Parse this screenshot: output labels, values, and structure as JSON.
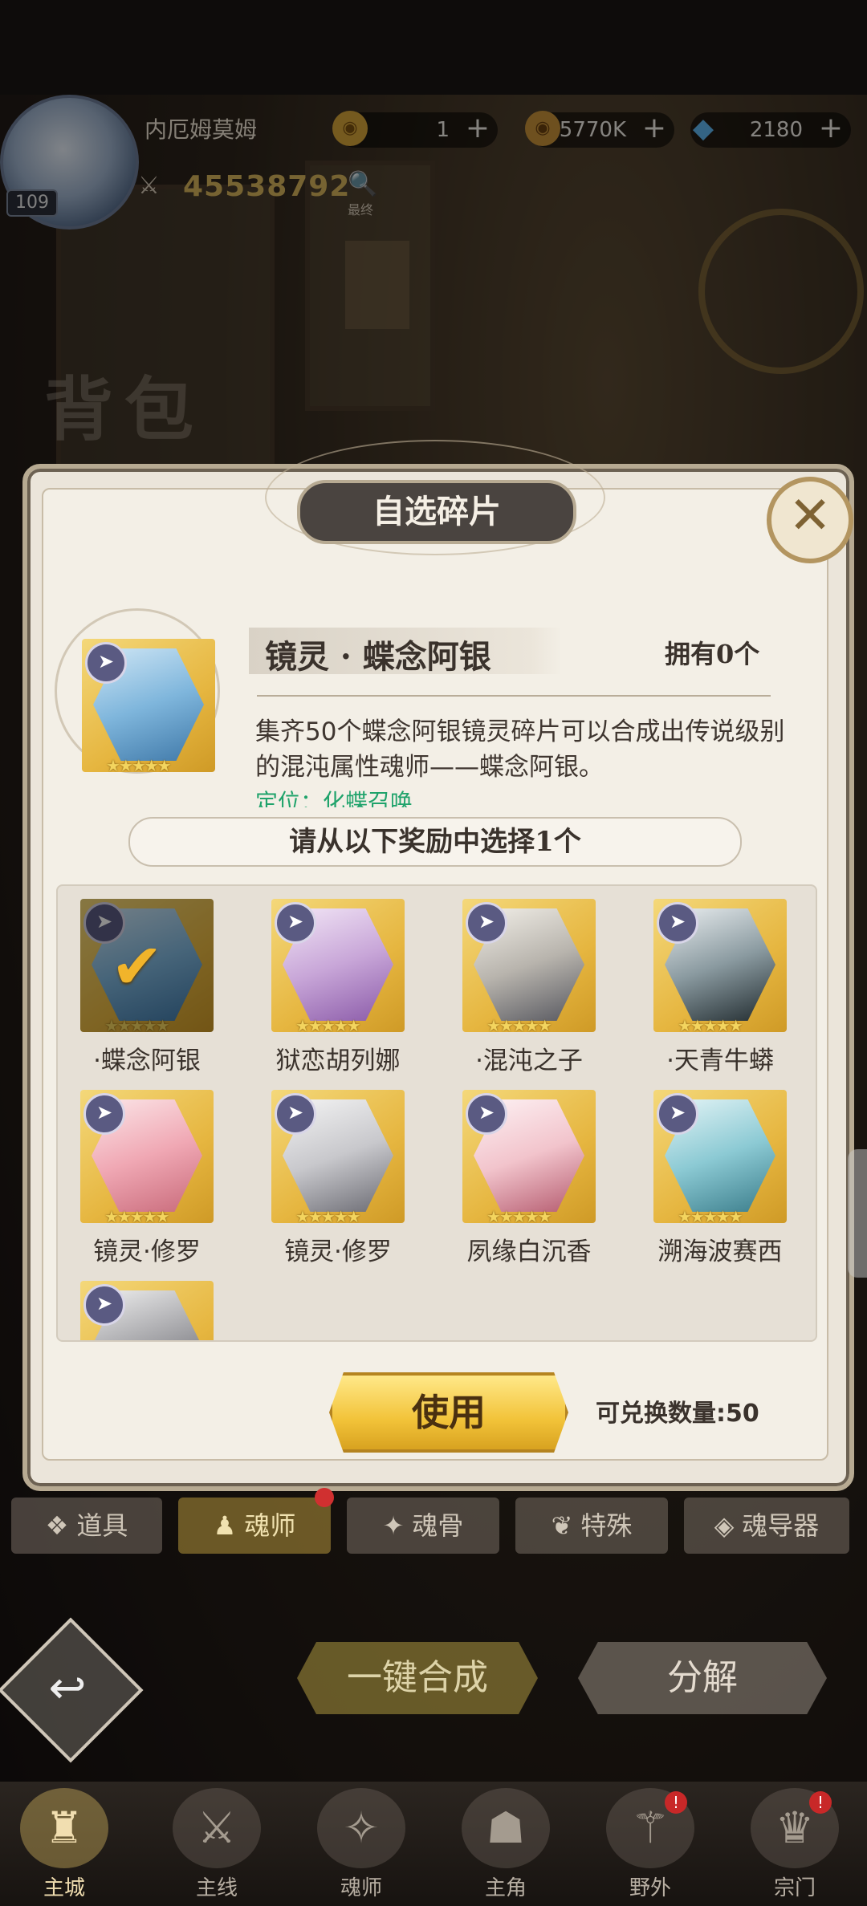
{
  "header": {
    "player_name": "内厄姆莫姆",
    "level": "109",
    "power": "45538792",
    "power_icon": "crossed-swords-icon",
    "search_sub": "最终",
    "resources": [
      {
        "icon": "gold-coin-icon",
        "value": "1"
      },
      {
        "icon": "silver-coin-icon",
        "value": "5770K"
      },
      {
        "icon": "diamond-icon",
        "value": "2180"
      }
    ]
  },
  "page_title": "背包",
  "modal": {
    "title": "自选碎片",
    "item": {
      "name": "镜灵 · 蝶念阿银",
      "owned": "拥有0个",
      "description": "集齐50个蝶念阿银镜灵碎片可以合成出传说级别的混沌属性魂师——蝶念阿银。",
      "position_text": "定位：化蝶召唤",
      "stars": "★★★★★"
    },
    "choose_text": "请从以下奖励中选择1个",
    "cards": [
      {
        "label": "·蝶念阿银",
        "selected": true
      },
      {
        "label": "狱恋胡列娜",
        "selected": false
      },
      {
        "label": "·混沌之子",
        "selected": false
      },
      {
        "label": "·天青牛蟒",
        "selected": false
      },
      {
        "label": "镜灵·修罗",
        "selected": false
      },
      {
        "label": "镜灵·修罗",
        "selected": false
      },
      {
        "label": "夙缘白沉香",
        "selected": false
      },
      {
        "label": "溯海波赛西",
        "selected": false
      },
      {
        "label": "",
        "selected": false
      }
    ],
    "use_label": "使用",
    "exchange_text": "可兑换数量:50"
  },
  "tabs": [
    {
      "label": "道具",
      "icon": "bag-icon",
      "active": false
    },
    {
      "label": "魂师",
      "icon": "soulmaster-icon",
      "active": true
    },
    {
      "label": "魂骨",
      "icon": "soulbone-icon",
      "active": false
    },
    {
      "label": "特殊",
      "icon": "wing-icon",
      "active": false
    },
    {
      "label": "魂导器",
      "icon": "gem-icon",
      "active": false
    }
  ],
  "actions": {
    "combine_label": "一键合成",
    "decompose_label": "分解"
  },
  "bottom_nav": [
    {
      "label": "主城",
      "icon": "castle-icon",
      "active": true,
      "badge": false
    },
    {
      "label": "主线",
      "icon": "mainline-icon",
      "active": false,
      "badge": false
    },
    {
      "label": "魂师",
      "icon": "book-icon",
      "active": false,
      "badge": false
    },
    {
      "label": "主角",
      "icon": "hero-icon",
      "active": false,
      "badge": false
    },
    {
      "label": "野外",
      "icon": "sword-icon",
      "active": false,
      "badge": true
    },
    {
      "label": "宗门",
      "icon": "sect-icon",
      "active": false,
      "badge": true
    }
  ],
  "colors": {
    "gold": "#e6b640",
    "modal_bg": "#f3efe6",
    "accent_green": "#1fa36b"
  }
}
